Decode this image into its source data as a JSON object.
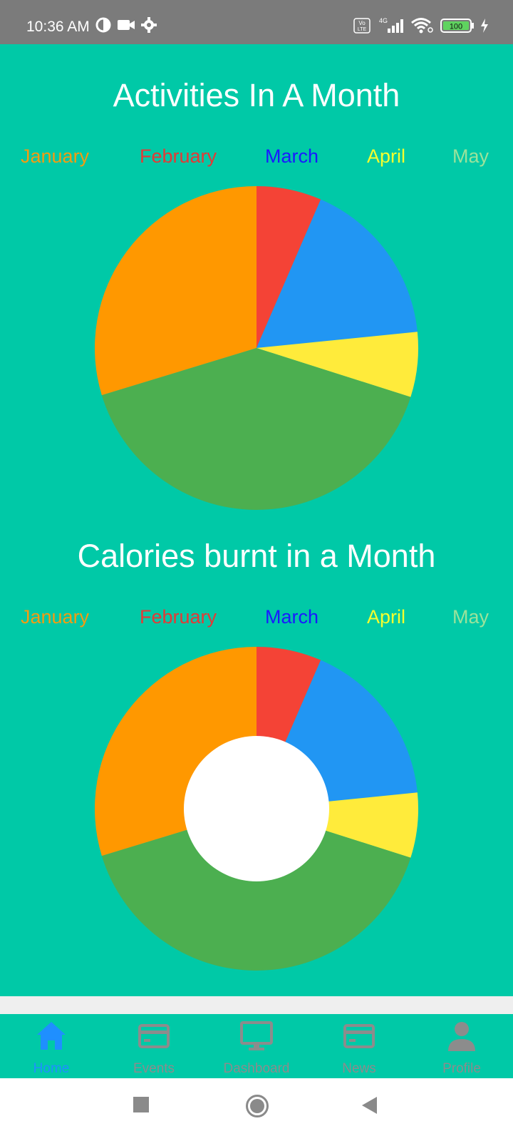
{
  "status_bar": {
    "time": "10:36 AM",
    "left_icons": [
      "pinwheel-icon",
      "video-camera-icon",
      "gear-icon"
    ],
    "network_badge_top": "Vo",
    "network_badge_bottom": "LTE",
    "network_type": "4G",
    "battery": "100",
    "right_icons": [
      "volte-icon",
      "signal-icon",
      "wifi-icon",
      "battery-icon",
      "charging-icon"
    ]
  },
  "colors": {
    "background": "#00c9a7",
    "status_bar": "#7b7b7b",
    "title": "#ffffff",
    "nav_active": "#1f8fff",
    "nav_inactive": "#8c8c8c",
    "separator": "#efefef"
  },
  "legend": [
    {
      "label": "January",
      "color": "#f39c12"
    },
    {
      "label": "February",
      "color": "#e53935"
    },
    {
      "label": "March",
      "color": "#1a1aff"
    },
    {
      "label": "April",
      "color": "#f4ff2e"
    },
    {
      "label": "May",
      "color": "#9be39b"
    }
  ],
  "chart_data": [
    {
      "type": "pie",
      "title": "Activities In A Month",
      "categories": [
        "February",
        "March",
        "April",
        "May",
        "January"
      ],
      "values": [
        6.5,
        16.9,
        6.5,
        40.4,
        29.7
      ],
      "colors": [
        "#f44336",
        "#2196f3",
        "#ffeb3b",
        "#4caf50",
        "#ff9800"
      ]
    },
    {
      "type": "pie",
      "subtype": "donut",
      "title": "Calories burnt in a Month",
      "categories": [
        "February",
        "March",
        "April",
        "May",
        "January"
      ],
      "values": [
        6.5,
        16.9,
        6.5,
        40.4,
        29.7
      ],
      "colors": [
        "#f44336",
        "#2196f3",
        "#ffeb3b",
        "#4caf50",
        "#ff9800"
      ]
    }
  ],
  "bottom_nav": [
    {
      "label": "Home",
      "icon": "home-icon",
      "active": true
    },
    {
      "label": "Events",
      "icon": "card-icon",
      "active": false
    },
    {
      "label": "Dashboard",
      "icon": "monitor-icon",
      "active": false
    },
    {
      "label": "News",
      "icon": "card-icon",
      "active": false
    },
    {
      "label": "Profile",
      "icon": "person-icon",
      "active": false
    }
  ],
  "system_nav": [
    "recents-square-icon",
    "home-circle-icon",
    "back-triangle-icon"
  ]
}
